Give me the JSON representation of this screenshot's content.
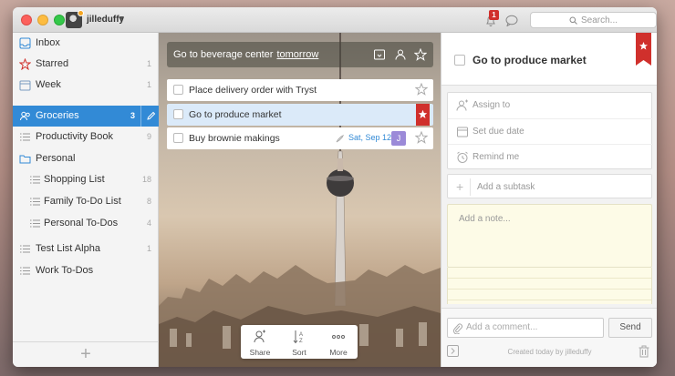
{
  "titlebar": {
    "username": "jilleduffy",
    "notification_count": "1",
    "search_placeholder": "Search..."
  },
  "sidebar": {
    "items": [
      {
        "label": "Inbox",
        "count": "",
        "icon": "inbox-icon"
      },
      {
        "label": "Starred",
        "count": "1",
        "icon": "star-icon"
      },
      {
        "label": "Week",
        "count": "1",
        "icon": "calendar-icon"
      },
      {
        "label": "Groceries",
        "count": "3",
        "icon": "shared-list-icon"
      },
      {
        "label": "Productivity Book",
        "count": "9",
        "icon": "list-icon"
      },
      {
        "label": "Personal",
        "count": "",
        "icon": "folder-icon"
      },
      {
        "label": "Shopping List",
        "count": "18",
        "icon": "list-icon"
      },
      {
        "label": "Family To-Do List",
        "count": "8",
        "icon": "list-icon"
      },
      {
        "label": "Personal To-Dos",
        "count": "4",
        "icon": "list-icon"
      },
      {
        "label": "Test List Alpha",
        "count": "1",
        "icon": "list-icon"
      },
      {
        "label": "Work To-Dos",
        "count": "",
        "icon": "list-icon"
      }
    ],
    "add_label": "+"
  },
  "center": {
    "add_task": {
      "text": "Go to beverage center",
      "keyword": "tomorrow"
    },
    "tasks": [
      {
        "title": "Place delivery order with Tryst",
        "starred": false
      },
      {
        "title": "Go to produce market",
        "starred": true
      },
      {
        "title": "Buy brownie makings",
        "date": "Sat, Sep 12",
        "assignee": "J",
        "starred": false
      }
    ],
    "toolbar": {
      "share": "Share",
      "sort": "Sort",
      "more": "More"
    }
  },
  "detail": {
    "title": "Go to produce market",
    "assign": "Assign to",
    "due": "Set due date",
    "remind": "Remind me",
    "subtask": "Add a subtask",
    "note": "Add a note...",
    "comment_placeholder": "Add a comment...",
    "send": "Send",
    "created": "Created today by jilleduffy"
  },
  "colors": {
    "accent": "#328ad6",
    "star_red": "#d0302c",
    "assignee": "#9b8ad8"
  }
}
